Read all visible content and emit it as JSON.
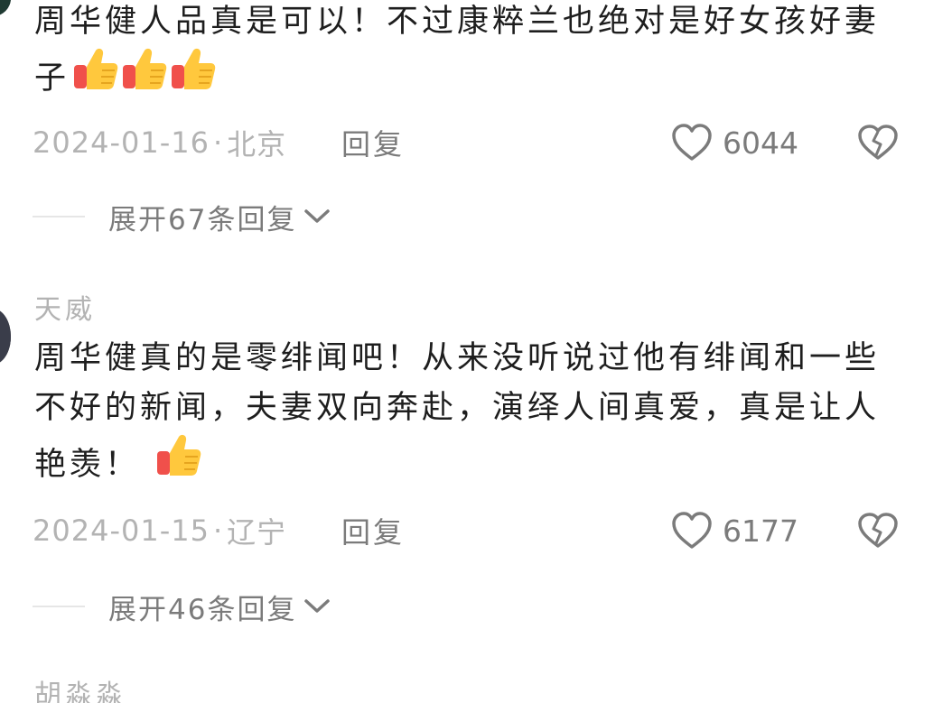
{
  "comments": [
    {
      "text": "周华健人品真是可以！不过康粹兰也绝对是好女孩好妻子",
      "emoji_count": 3,
      "emoji_icon": "thumbs-up-icon",
      "date": "2024-01-16",
      "location": "北京",
      "reply_label": "回复",
      "likes": "6044",
      "expand_label": "展开67条回复"
    },
    {
      "username": "天威",
      "text": "周华健真的是零绯闻吧！从来没听说过他有绯闻和一些不好的新闻，夫妻双向奔赴，演绎人间真爱，真是让人艳羡！",
      "emoji_count": 1,
      "emoji_icon": "thumbs-up-icon",
      "date": "2024-01-15",
      "location": "辽宁",
      "reply_label": "回复",
      "likes": "6177",
      "expand_label": "展开46条回复"
    },
    {
      "username": "胡淼淼"
    }
  ],
  "separator": "·",
  "colors": {
    "text_primary": "#1e1e1e",
    "text_secondary": "#7b7b7b",
    "text_muted": "#b3b3b3",
    "divider": "#e6e6e6",
    "emoji_yellow": "#ffc83d",
    "emoji_red": "#f0504b"
  }
}
